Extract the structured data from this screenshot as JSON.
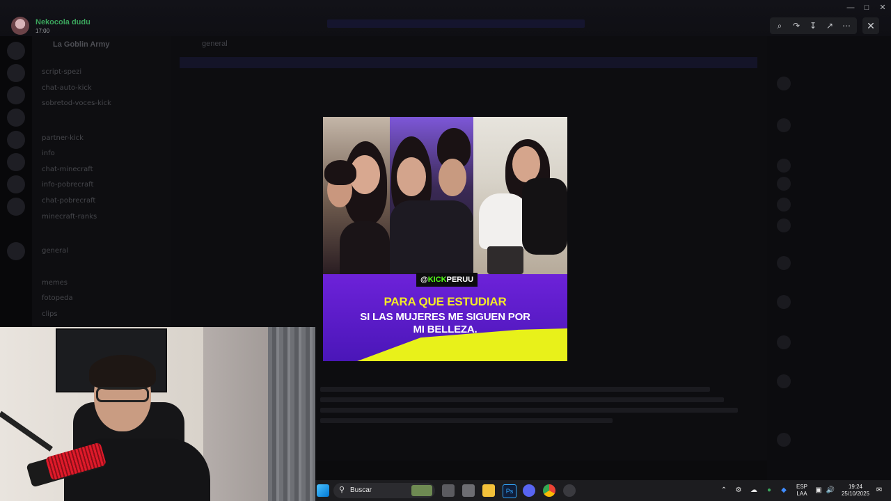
{
  "window": {
    "title": "La Goblin Army"
  },
  "viewer": {
    "author": "Nekocola dudu",
    "timestamp": "17:00",
    "tools": [
      "zoom-in-icon",
      "forward-icon",
      "download-icon",
      "open-external-icon",
      "more-icon"
    ]
  },
  "background": {
    "server_name": "La Goblin Army",
    "channels": [
      "script-spezi",
      "chat-auto-kick",
      "sobretod-voces-kick",
      "partner-kick",
      "info",
      "chat-minecraft",
      "info-pobrecraft",
      "chat-pobrecraft",
      "minecraft-ranks",
      "general",
      "memes",
      "fotopeda",
      "clips"
    ],
    "active_channel": "general"
  },
  "media": {
    "handle_prefix": "@",
    "handle_kick": "KICK",
    "handle_rest": "PERUU",
    "caption_line1": "PARA QUE ESTUDIAR",
    "caption_line2": "SI LAS MUJERES ME SIGUEN POR",
    "caption_line3": "MI BELLEZA."
  },
  "taskbar": {
    "search_placeholder": "Buscar",
    "language": "ESP",
    "layout": "LAA",
    "time": "19:24",
    "date": "25/10/2025"
  },
  "colors": {
    "author_green": "#3ba55c",
    "caption_yellow": "#f4ea27",
    "kick_green": "#53fc18",
    "media_purple": "#5a1cc8"
  }
}
